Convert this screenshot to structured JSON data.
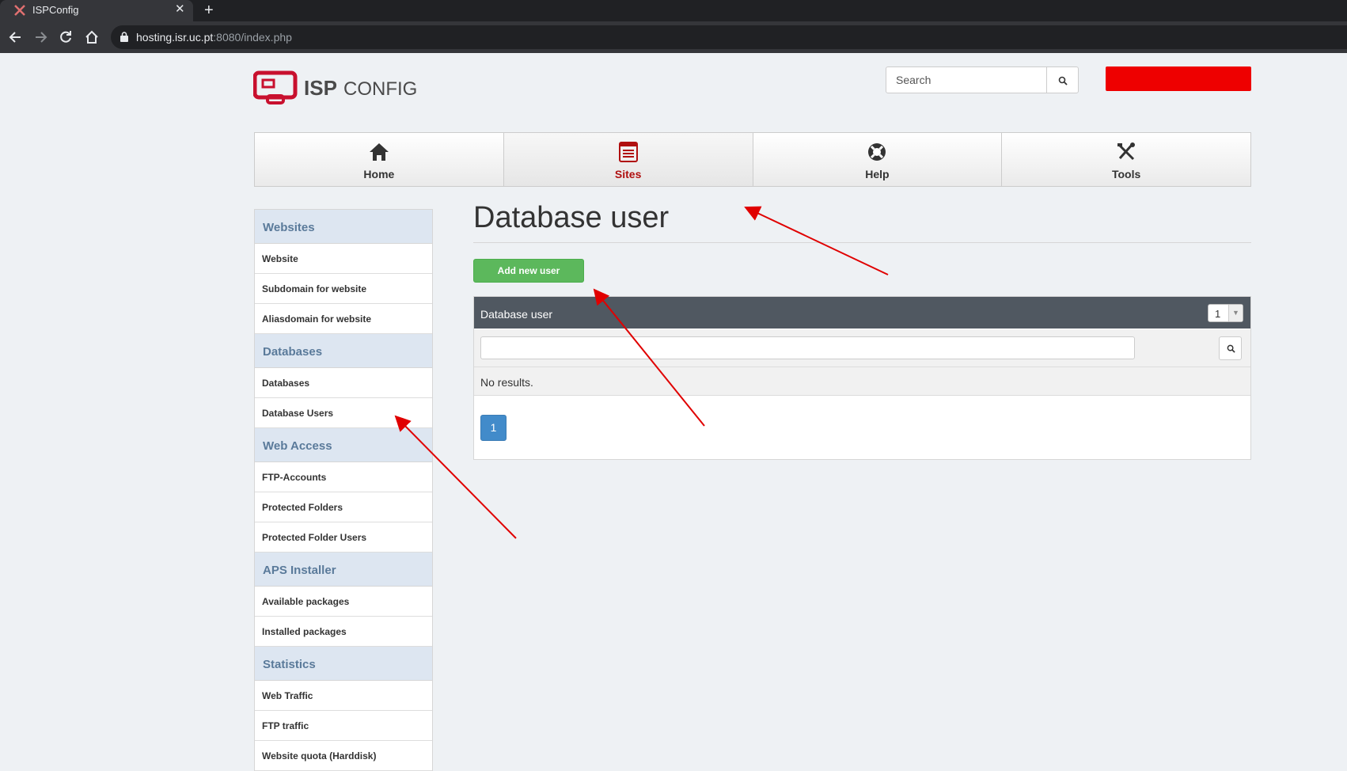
{
  "browser": {
    "tab_title": "ISPConfig",
    "tab_close": "✕",
    "new_tab": "+",
    "url_host": "hosting.isr.uc.pt",
    "url_rest": ":8080/index.php"
  },
  "header": {
    "logo_text": "ISPCONFIG",
    "search_placeholder": "Search"
  },
  "mainnav": [
    {
      "label": "Home",
      "icon": "home-icon"
    },
    {
      "label": "Sites",
      "icon": "sites-icon",
      "active": true
    },
    {
      "label": "Help",
      "icon": "lifebuoy-icon"
    },
    {
      "label": "Tools",
      "icon": "tools-icon"
    }
  ],
  "sidebar": {
    "sections": [
      {
        "title": "Websites",
        "items": [
          "Website",
          "Subdomain for website",
          "Aliasdomain for website"
        ]
      },
      {
        "title": "Databases",
        "items": [
          "Databases",
          "Database Users"
        ]
      },
      {
        "title": "Web Access",
        "items": [
          "FTP-Accounts",
          "Protected Folders",
          "Protected Folder Users"
        ]
      },
      {
        "title": "APS Installer",
        "items": [
          "Available packages",
          "Installed packages"
        ]
      },
      {
        "title": "Statistics",
        "items": [
          "Web Traffic",
          "FTP traffic",
          "Website quota (Harddisk)"
        ]
      }
    ]
  },
  "content": {
    "title": "Database user",
    "add_button": "Add new user",
    "panel_title": "Database user",
    "page_select_value": "1",
    "no_results": "No results.",
    "current_page": "1"
  },
  "colors": {
    "accent_red": "#ee0000",
    "add_green": "#5cb85c",
    "pager_blue": "#428bca",
    "panel_header": "#505861"
  }
}
